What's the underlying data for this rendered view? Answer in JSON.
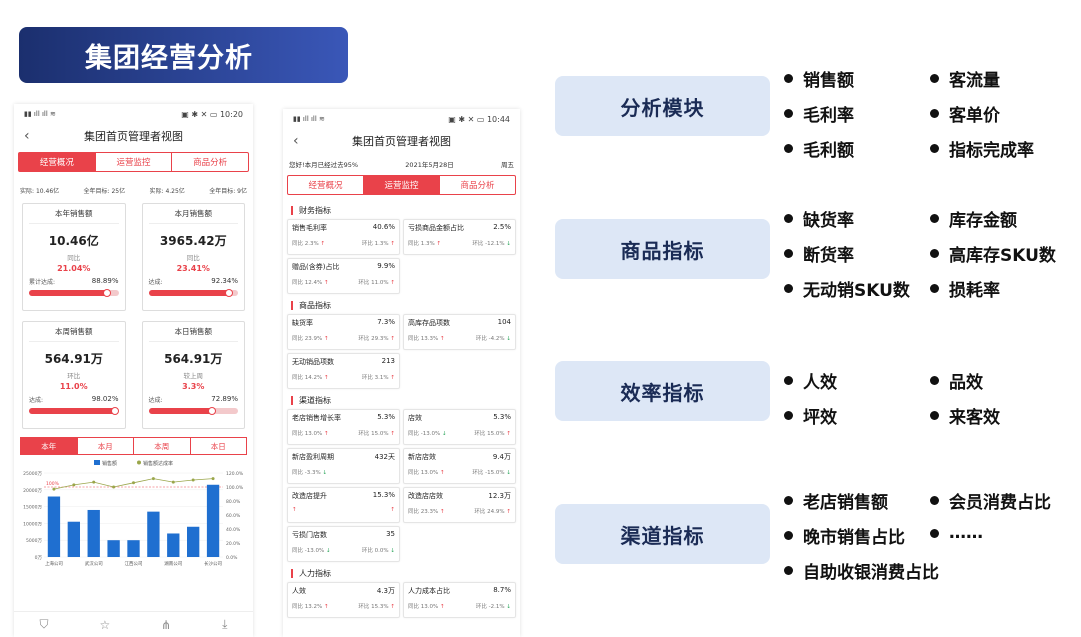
{
  "banner": {
    "title": "集团经营分析"
  },
  "phone1": {
    "status": {
      "left": "▮▮ ıll ıll ≋",
      "time": "10:20",
      "icons": "▣ ✱ ✕ ▭"
    },
    "title": "集团首页管理者视图",
    "tabs": [
      "经营概况",
      "运营监控",
      "商品分析"
    ],
    "summary": [
      {
        "label": "实际:",
        "value": "10.46亿"
      },
      {
        "label": "全年目标:",
        "value": "25亿"
      },
      {
        "label": "实际:",
        "value": "4.25亿"
      },
      {
        "label": "全年目标:",
        "value": "9亿"
      }
    ],
    "cards": [
      {
        "title": "本年销售额",
        "value": "10.46亿",
        "cmp": "同比",
        "pct": "21.04%",
        "plabel": "累计达成:",
        "pval": "88.89%",
        "fill": 0.8889
      },
      {
        "title": "本月销售额",
        "value": "3965.42万",
        "cmp": "同比",
        "pct": "23.41%",
        "plabel": "达成:",
        "pval": "92.34%",
        "fill": 0.9234
      },
      {
        "title": "本周销售额",
        "value": "564.91万",
        "cmp": "环比",
        "pct": "11.0%",
        "plabel": "达成:",
        "pval": "98.02%",
        "fill": 0.9802
      },
      {
        "title": "本日销售额",
        "value": "564.91万",
        "cmp": "较上周",
        "pct": "3.3%",
        "plabel": "达成:",
        "pval": "72.89%",
        "fill": 0.7289
      }
    ],
    "periods": [
      "本年",
      "本月",
      "本周",
      "本日"
    ],
    "icons": [
      "filter-icon",
      "star-icon",
      "share-icon",
      "download-icon"
    ]
  },
  "chart_data": {
    "type": "bar",
    "legend": [
      "销售额",
      "销售额达成率"
    ],
    "categories": [
      "上海公司",
      "武汉公司",
      "江西公司",
      "湖南公司",
      "长沙公司"
    ],
    "bars": [
      18000,
      10500,
      14000,
      5000,
      5000,
      13500,
      7000,
      9000,
      21500
    ],
    "line": [
      97,
      103,
      107,
      100,
      106,
      112,
      107,
      110,
      112
    ],
    "yleft": [
      "25000万",
      "20000万",
      "15000万",
      "10000万",
      "5000万",
      "0万"
    ],
    "yright": [
      "120.0%",
      "100.0%",
      "80.0%",
      "60.0%",
      "40.0%",
      "20.0%",
      "0.0%"
    ],
    "ylim": [
      0,
      25000
    ],
    "y2lim": [
      0,
      120
    ],
    "target_label": "100%"
  },
  "phone2": {
    "status": {
      "left": "▮▮ ıll ıll ≋",
      "time": "10:44",
      "icons": "▣ ✱ ✕ ▭"
    },
    "title": "集团首页管理者视图",
    "hello": [
      "您好!本月已经过去95%",
      "2021年5月28日",
      "周五"
    ],
    "tabs": [
      "经营概况",
      "运营监控",
      "商品分析"
    ],
    "sections": [
      {
        "name": "财务指标",
        "items": [
          {
            "n": "销售毛利率",
            "v": "40.6%",
            "a": "同比",
            "av": "2.3%",
            "ad": "↑",
            "b": "环比",
            "bv": "1.3%",
            "bd": "↑"
          },
          {
            "n": "亏损商品金额占比",
            "v": "2.5%",
            "a": "同比",
            "av": "1.3%",
            "ad": "↑",
            "b": "环比",
            "bv": "-12.1%",
            "bd": "↓"
          },
          {
            "n": "赠品(含券)占比",
            "v": "9.9%",
            "a": "同比",
            "av": "12.4%",
            "ad": "↑",
            "b": "环比",
            "bv": "11.0%",
            "bd": "↑"
          }
        ]
      },
      {
        "name": "商品指标",
        "items": [
          {
            "n": "缺货率",
            "v": "7.3%",
            "a": "同比",
            "av": "23.9%",
            "ad": "↑",
            "b": "环比",
            "bv": "29.3%",
            "bd": "↑"
          },
          {
            "n": "高库存品项数",
            "v": "104",
            "a": "同比",
            "av": "13.3%",
            "ad": "↑",
            "b": "环比",
            "bv": "-4.2%",
            "bd": "↓"
          },
          {
            "n": "无动销品项数",
            "v": "213",
            "a": "同比",
            "av": "14.2%",
            "ad": "↑",
            "b": "环比",
            "bv": "3.1%",
            "bd": "↑"
          }
        ]
      },
      {
        "name": "渠道指标",
        "items": [
          {
            "n": "老店销售增长率",
            "v": "5.3%",
            "a": "同比",
            "av": "13.0%",
            "ad": "↑",
            "b": "环比",
            "bv": "15.0%",
            "bd": "↑"
          },
          {
            "n": "店效",
            "v": "5.3%",
            "a": "同比",
            "av": "-13.0%",
            "ad": "↓",
            "b": "环比",
            "bv": "15.0%",
            "bd": "↑"
          },
          {
            "n": "新店盈利周期",
            "v": "432天",
            "a": "同比",
            "av": "-3.3%",
            "ad": "↓",
            "b": "",
            "bv": "",
            "bd": ""
          },
          {
            "n": "新店店效",
            "v": "9.4万",
            "a": "同比",
            "av": "13.0%",
            "ad": "↑",
            "b": "环比",
            "bv": "-15.0%",
            "bd": "↓"
          },
          {
            "n": "改造店提升",
            "v": "15.3%",
            "a": "",
            "av": "",
            "ad": "↑",
            "b": "",
            "bv": "",
            "bd": "↑"
          },
          {
            "n": "改造店店效",
            "v": "12.3万",
            "a": "同比",
            "av": "23.3%",
            "ad": "↑",
            "b": "环比",
            "bv": "24.9%",
            "bd": "↑"
          },
          {
            "n": "亏损门店数",
            "v": "35",
            "a": "同比",
            "av": "-13.0%",
            "ad": "↓",
            "b": "环比",
            "bv": "0.0%",
            "bd": "↓"
          }
        ]
      },
      {
        "name": "人力指标",
        "items": [
          {
            "n": "人效",
            "v": "4.3万",
            "a": "同比",
            "av": "13.2%",
            "ad": "↑",
            "b": "环比",
            "bv": "15.3%",
            "bd": "↑"
          },
          {
            "n": "人力成本占比",
            "v": "8.7%",
            "a": "同比",
            "av": "13.0%",
            "ad": "↑",
            "b": "环比",
            "bv": "-2.1%",
            "bd": "↓"
          }
        ]
      }
    ]
  },
  "right": {
    "panels": [
      "分析模块",
      "商品指标",
      "效率指标",
      "渠道指标"
    ],
    "groups": [
      [
        "销售额",
        "客流量",
        "毛利率",
        "客单价",
        "毛利额",
        "指标完成率"
      ],
      [
        "缺货率",
        "库存金额",
        "断货率",
        "高库存SKU数",
        "无动销SKU数",
        "损耗率"
      ],
      [
        "人效",
        "品效",
        "坪效",
        "来客效"
      ],
      [
        "老店销售额",
        "会员消费占比",
        "晚市销售占比",
        "……",
        "自助收银消费占比"
      ]
    ]
  }
}
